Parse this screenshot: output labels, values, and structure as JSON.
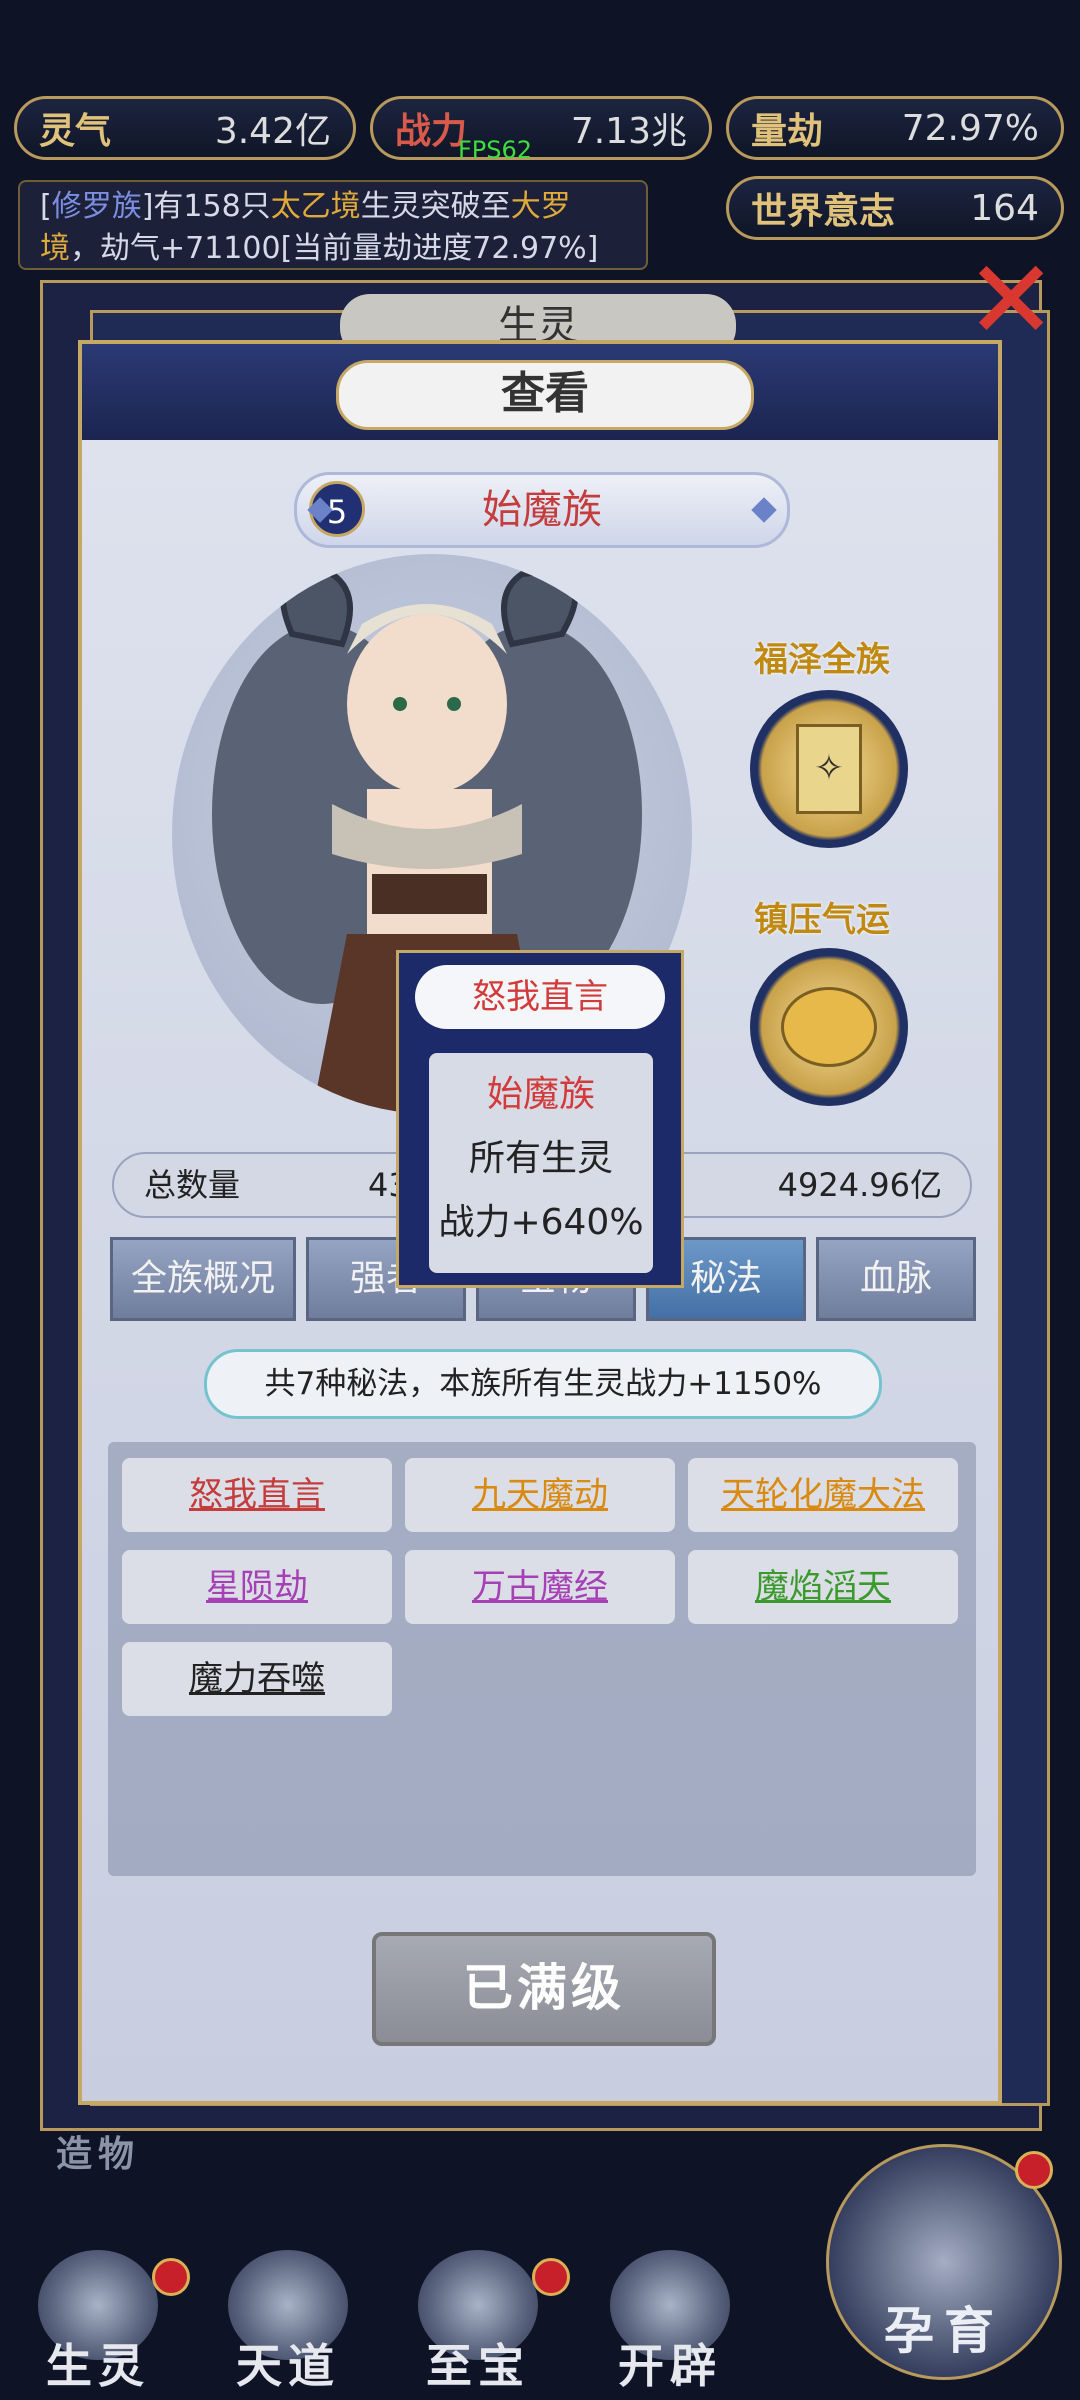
{
  "top_stats": [
    {
      "label": "灵气",
      "value": "3.42亿"
    },
    {
      "label": "战力",
      "value": "7.13兆"
    },
    {
      "label": "量劫",
      "value": "72.97%"
    },
    {
      "label": "世界意志",
      "value": "164"
    }
  ],
  "fps": "FPS62",
  "marquee": {
    "p1": "[",
    "race": "修罗族",
    "p2": "]有158只",
    "realm": "太乙境",
    "p3": "生灵突破至",
    "target": "大罗境",
    "p4": "，劫气+71100[当前量劫进度72.97%]"
  },
  "back_panel_title": "生灵",
  "dialog": {
    "title": "查看",
    "race": {
      "level": "5",
      "name": "始魔族"
    },
    "perks": [
      "福泽全族",
      "镇压气运"
    ],
    "count": {
      "label": "总数量",
      "value": "43.5",
      "right_value": "4924.96亿"
    },
    "tabs": [
      "全族概况",
      "强者",
      "宝物",
      "秘法",
      "血脉"
    ],
    "summary": "共7种秘法，本族所有生灵战力+1150%",
    "spells": [
      {
        "name": "怒我直言",
        "color": "#c43c3c"
      },
      {
        "name": "九天魔动",
        "color": "#d98a10"
      },
      {
        "name": "天轮化魔大法",
        "color": "#d98a10"
      },
      {
        "name": "星陨劫",
        "color": "#a640b5"
      },
      {
        "name": "万古魔经",
        "color": "#a640b5"
      },
      {
        "name": "魔焰滔天",
        "color": "#3a9a2c"
      },
      {
        "name": "魔力吞噬",
        "color": "#222222"
      }
    ],
    "max_button": "已满级"
  },
  "tooltip": {
    "title": "怒我直言",
    "race": "始魔族",
    "line1": "所有生灵",
    "line2": "战力+640%"
  },
  "side_label": "造物",
  "nav": [
    "生灵",
    "天道",
    "至宝",
    "开辟"
  ],
  "hatch_button": "孕育"
}
